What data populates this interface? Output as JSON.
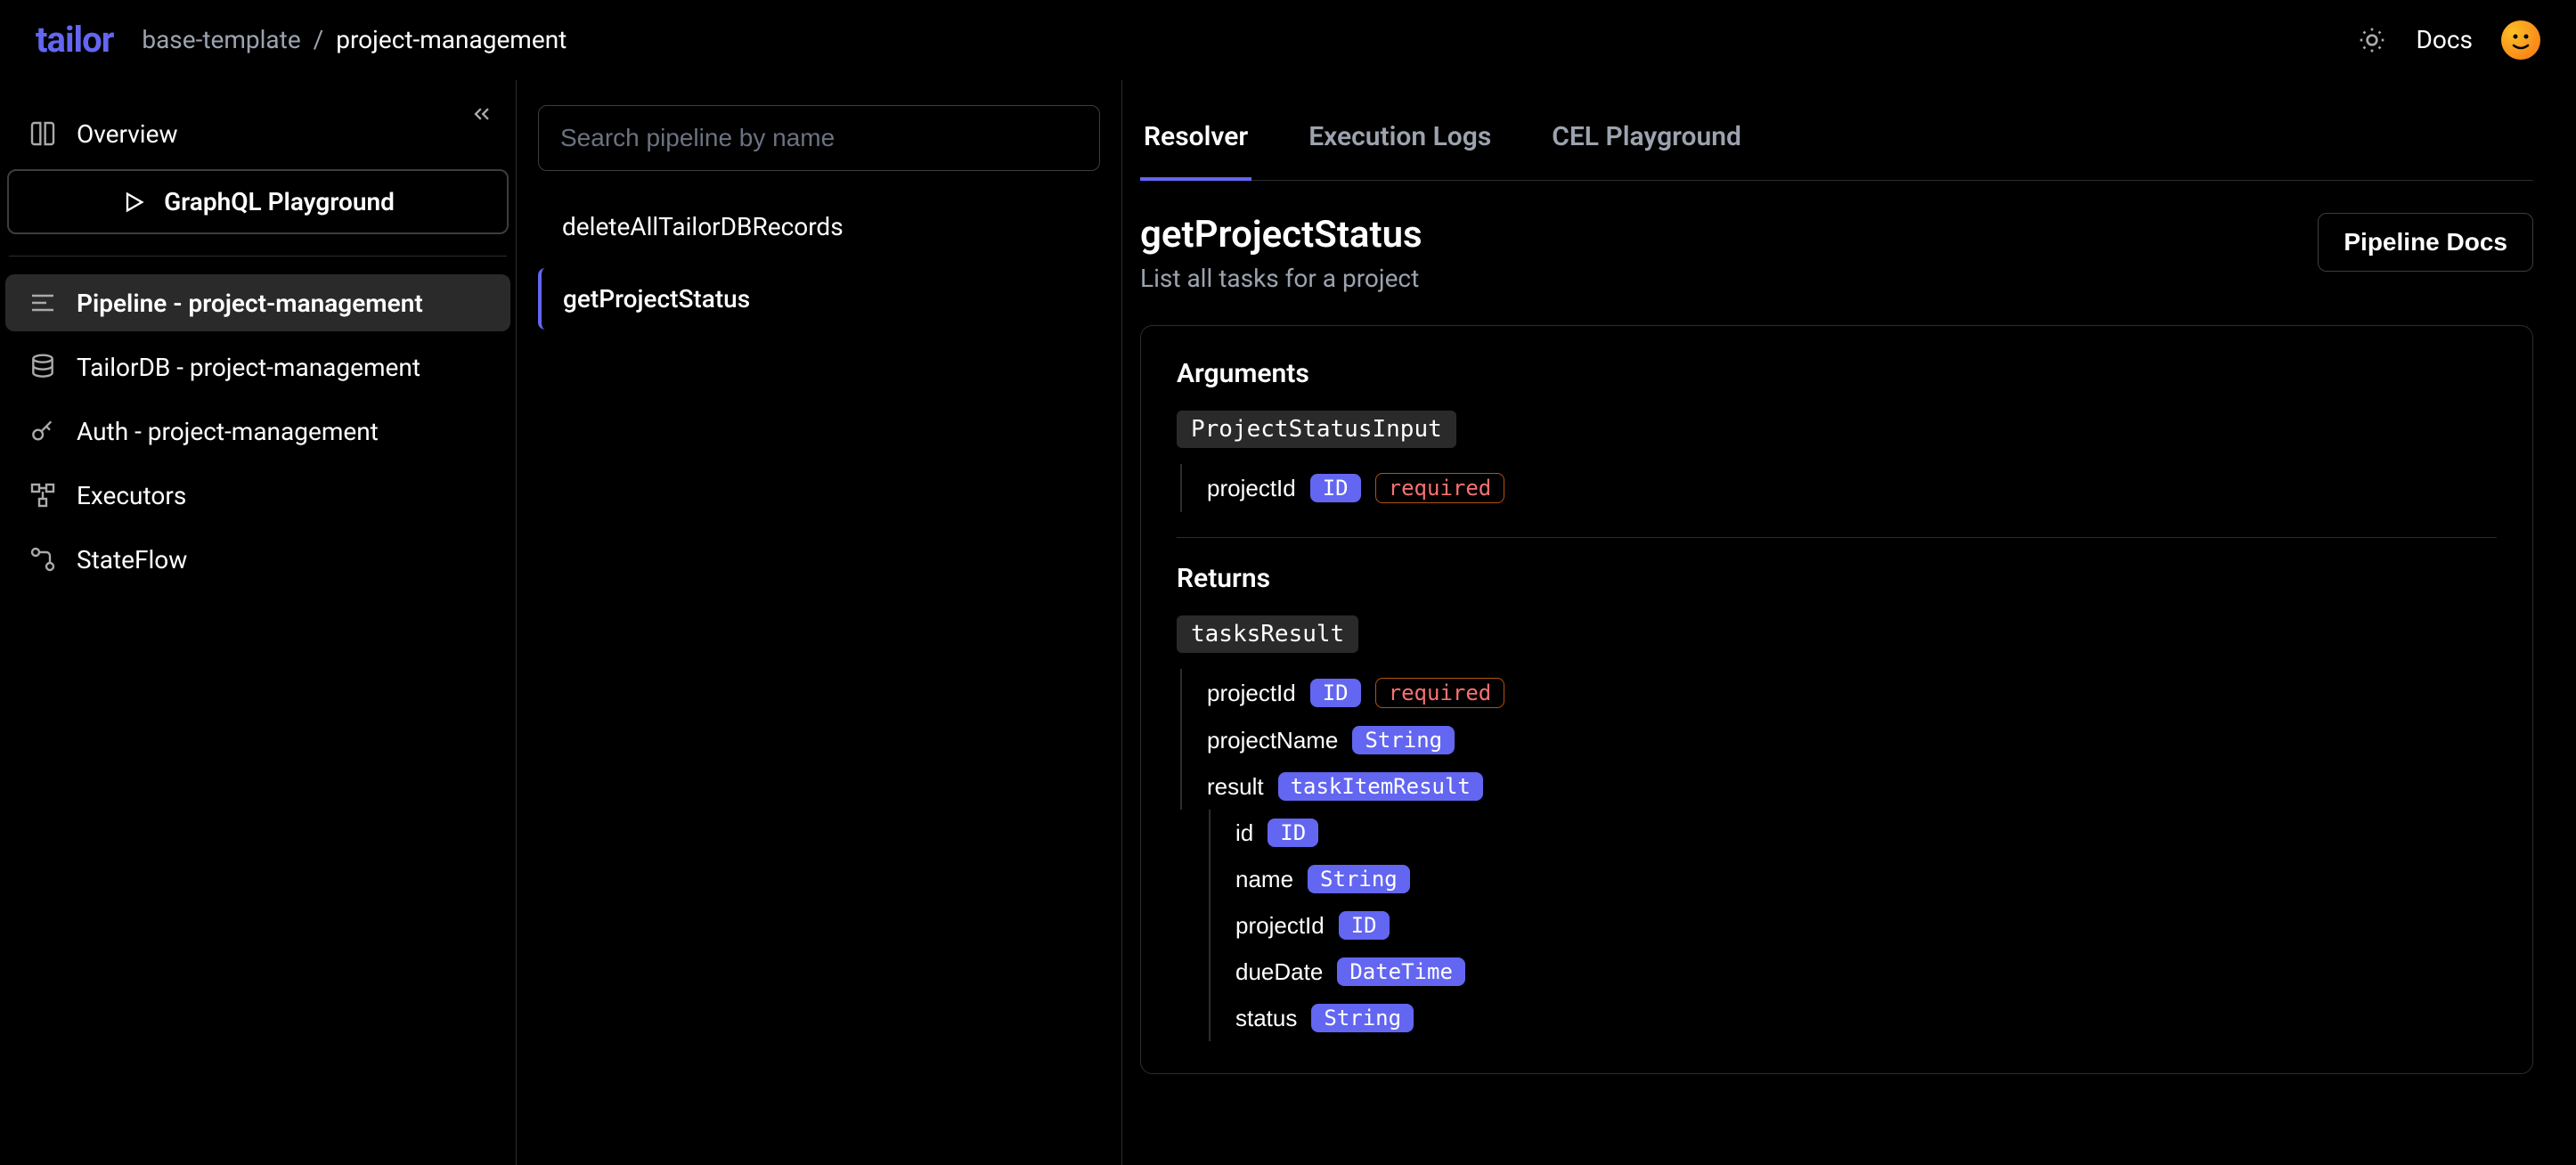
{
  "header": {
    "logo": "tailor",
    "breadcrumb": [
      "base-template",
      "project-management"
    ],
    "docs_label": "Docs"
  },
  "sidebar": {
    "overview_label": "Overview",
    "playground_label": "GraphQL Playground",
    "items": [
      {
        "label": "Pipeline - project-management",
        "active": true
      },
      {
        "label": "TailorDB - project-management"
      },
      {
        "label": "Auth - project-management"
      },
      {
        "label": "Executors"
      },
      {
        "label": "StateFlow"
      }
    ]
  },
  "pipeline_list": {
    "search_placeholder": "Search pipeline by name",
    "items": [
      {
        "name": "deleteAllTailorDBRecords"
      },
      {
        "name": "getProjectStatus",
        "active": true
      }
    ]
  },
  "tabs": [
    {
      "label": "Resolver",
      "active": true
    },
    {
      "label": "Execution Logs"
    },
    {
      "label": "CEL Playground"
    }
  ],
  "detail": {
    "title": "getProjectStatus",
    "subtitle": "List all tasks for a project",
    "docs_button": "Pipeline Docs",
    "arguments_label": "Arguments",
    "returns_label": "Returns",
    "input_type": "ProjectStatusInput",
    "input_fields": [
      {
        "name": "projectId",
        "type": "ID",
        "required": true
      }
    ],
    "return_type": "tasksResult",
    "return_fields": [
      {
        "name": "projectId",
        "type": "ID",
        "required": true
      },
      {
        "name": "projectName",
        "type": "String"
      },
      {
        "name": "result",
        "type": "taskItemResult",
        "children": [
          {
            "name": "id",
            "type": "ID"
          },
          {
            "name": "name",
            "type": "String"
          },
          {
            "name": "projectId",
            "type": "ID"
          },
          {
            "name": "dueDate",
            "type": "DateTime"
          },
          {
            "name": "status",
            "type": "String"
          }
        ]
      }
    ],
    "required_text": "required"
  }
}
